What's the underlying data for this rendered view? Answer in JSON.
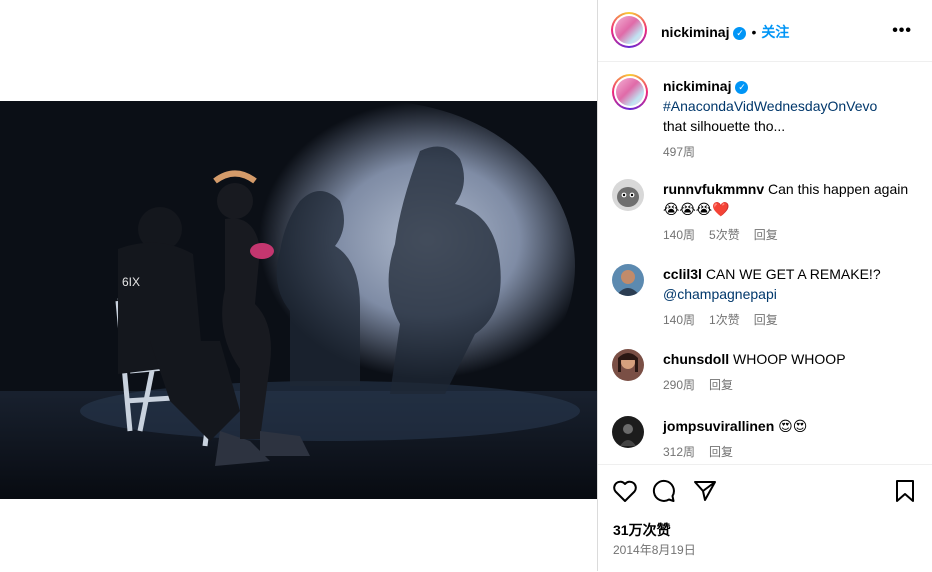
{
  "post": {
    "username": "nickiminaj",
    "verified_mark": "✓",
    "separator": "•",
    "follow_label": "关注",
    "more_label": "•••"
  },
  "caption": {
    "username": "nickiminaj",
    "hashtag": "#AnacondaVidWednesdayOnVevo",
    "text": "that silhouette tho...",
    "age": "497周"
  },
  "comments": [
    {
      "username": "runnvfukmmnv",
      "text": "Can this happen again 😭😭😭❤️",
      "age": "140周",
      "likes": "5次赞",
      "reply": "回复",
      "avatar_color": "#8a8a8a"
    },
    {
      "username": "cclil3l",
      "text": "CAN WE GET A REMAKE!?",
      "mention": "@champagnepapi",
      "age": "140周",
      "likes": "1次赞",
      "reply": "回复",
      "avatar_color": "#3d6a8c"
    },
    {
      "username": "chunsdoll",
      "text": "WHOOP WHOOP",
      "age": "290周",
      "reply": "回复",
      "avatar_color": "#5a3d3a"
    },
    {
      "username": "jompsuvirallinen",
      "text": "😍😍",
      "age": "312周",
      "reply": "回复",
      "avatar_color": "#1c1c1c"
    }
  ],
  "actions": {
    "like_icon": "heart-icon",
    "comment_icon": "comment-icon",
    "share_icon": "share-icon",
    "save_icon": "bookmark-icon"
  },
  "stats": {
    "likes": "31万次赞",
    "date": "2014年8月19日"
  },
  "colors": {
    "accent": "#0095f6",
    "link": "#00376b",
    "muted": "#737373"
  }
}
